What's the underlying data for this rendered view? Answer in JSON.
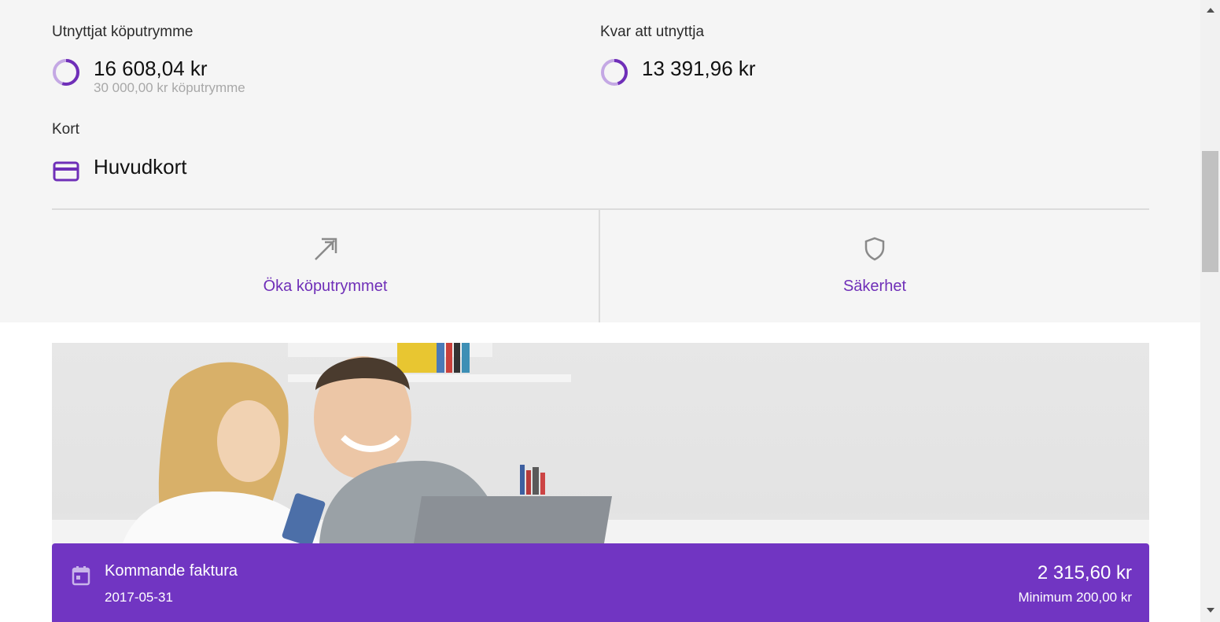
{
  "colors": {
    "accent": "#6f2fb8",
    "invoice_bg": "#7135c2",
    "ring_light": "#c4a8e4",
    "ring_dark": "#6f2fb8",
    "panel_bg": "#f5f5f5"
  },
  "summary": {
    "used": {
      "label": "Utnyttjat köputrymme",
      "amount": "16 608,04 kr",
      "limit_text": "30 000,00 kr köputrymme",
      "icon": "progress-ring-icon",
      "fraction": 0.55
    },
    "remaining": {
      "label": "Kvar att utnyttja",
      "amount": "13 391,96 kr",
      "icon": "progress-ring-icon",
      "fraction": 0.45
    }
  },
  "card": {
    "label": "Kort",
    "name": "Huvudkort",
    "icon": "credit-card-icon"
  },
  "actions": [
    {
      "label": "Öka köputrymmet",
      "icon": "arrow-up-right-icon"
    },
    {
      "label": "Säkerhet",
      "icon": "shield-icon"
    }
  ],
  "promo": {
    "description_icon": "promo-image"
  },
  "invoice": {
    "title": "Kommande faktura",
    "date": "2017-05-31",
    "amount": "2 315,60 kr",
    "minimum": "Minimum 200,00 kr",
    "icon": "calendar-icon"
  }
}
